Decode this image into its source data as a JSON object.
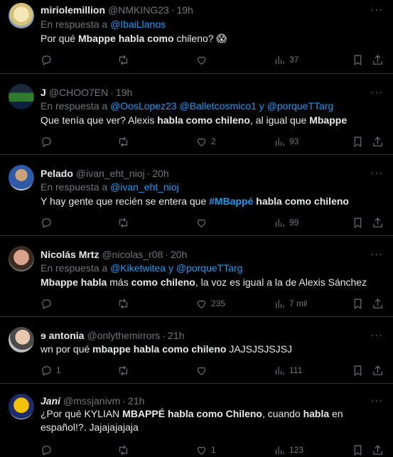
{
  "tweets": [
    {
      "name": "miriolemillion",
      "handle": "@NMKING23",
      "time": "19h",
      "reply_prefix": "En respuesta a",
      "reply_to": "@IbaiLlanos",
      "text_parts": [
        "Por qué ",
        "Mbappe habla como",
        " chileno? 😱"
      ],
      "replies": "",
      "retweets": "",
      "likes": "",
      "views": "37"
    },
    {
      "name": "J",
      "handle": "@CHOO7EN",
      "time": "19h",
      "reply_prefix": "En respuesta a",
      "reply_to": "@OosLopez23 @Balletcosmico1 y @porqueTTarg",
      "text_parts": [
        "Que tenía que ver? Alexis ",
        "habla como chileno",
        ", al igual que ",
        "Mbappe"
      ],
      "replies": "",
      "retweets": "",
      "likes": "2",
      "views": "93"
    },
    {
      "name": "Pelado",
      "handle": "@ivan_eht_nioj",
      "time": "20h",
      "reply_prefix": "En respuesta a",
      "reply_to": "@ivan_eht_nioj",
      "text_parts": [
        "Y hay gente que recién se entera que ",
        "#MBappé",
        " habla como chileno"
      ],
      "replies": "",
      "retweets": "",
      "likes": "",
      "views": "99"
    },
    {
      "name": "Nicolás Mrtz",
      "handle": "@nicolas_r08",
      "time": "20h",
      "reply_prefix": "En respuesta a",
      "reply_to": "@Kiketwitea y @porqueTTarg",
      "text_parts": [
        "Mbappe habla",
        " más ",
        "como chileno",
        ", la voz es igual a la de Alexis Sánchez"
      ],
      "replies": "",
      "retweets": "",
      "likes": "235",
      "views": "7 mil"
    },
    {
      "name": "ɘ antonia",
      "handle": "@onlythemirrors",
      "time": "21h",
      "text_parts": [
        "wn por qué ",
        "mbappe habla como chileno",
        " JAJSJSJSJSJ"
      ],
      "replies": "1",
      "retweets": "",
      "likes": "",
      "views": "111"
    },
    {
      "name": "Jani",
      "handle": "@mssjanivm",
      "time": "21h",
      "text_parts": [
        "¿Por qué KYLIAN ",
        "MBAPPÉ habla como Chileno",
        ", cuando ",
        "habla",
        " en español!?. Jajajajajaja"
      ],
      "replies": "",
      "retweets": "",
      "likes": "1",
      "views": "123"
    }
  ],
  "more_glyph": "···",
  "icons": [
    "reply-icon",
    "retweet-icon",
    "like-icon",
    "views-icon",
    "bookmark-icon",
    "share-icon"
  ]
}
